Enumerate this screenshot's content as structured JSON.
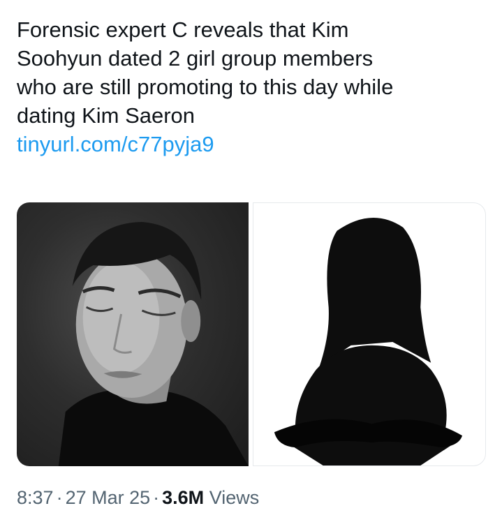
{
  "tweet": {
    "text_lines": [
      "Forensic expert C reveals that Kim",
      "Soohyun dated 2 girl group members",
      "who are still promoting to this day while",
      "dating Kim Saeron"
    ],
    "link": "tinyurl.com/c77pyja9"
  },
  "media": [
    {
      "name": "man-portrait-photo"
    },
    {
      "name": "silhouette-woman-photo"
    }
  ],
  "meta": {
    "time": "8:37",
    "separator": "·",
    "date": "27 Mar 25",
    "views_count": "3.6M",
    "views_label": "Views"
  },
  "colors": {
    "text": "#0f1419",
    "link": "#1d9bf0",
    "secondary": "#536471"
  }
}
